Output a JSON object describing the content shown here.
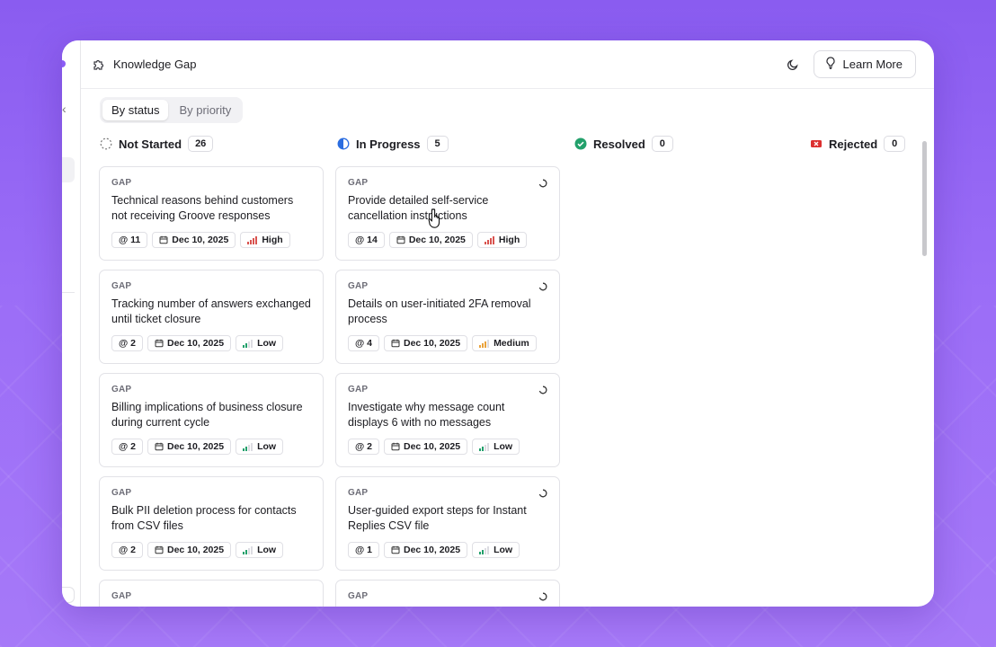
{
  "app": {
    "title": "Knowledge Gap"
  },
  "header": {
    "learn_more_label": "Learn More"
  },
  "view_toggle": {
    "options": [
      "By status",
      "By priority"
    ],
    "active": "By status"
  },
  "columns": [
    {
      "name": "Not Started",
      "count": "26"
    },
    {
      "name": "In Progress",
      "count": "5"
    },
    {
      "name": "Resolved",
      "count": "0"
    },
    {
      "name": "Rejected",
      "count": "0"
    }
  ],
  "cards": {
    "not_started": [
      {
        "tag": "GAP",
        "title": "Technical reasons behind customers not receiving Groove responses",
        "mentions": "@ 11",
        "date": "Dec 10, 2025",
        "priority": "High"
      },
      {
        "tag": "GAP",
        "title": "Tracking number of answers exchanged until ticket closure",
        "mentions": "@ 2",
        "date": "Dec 10, 2025",
        "priority": "Low"
      },
      {
        "tag": "GAP",
        "title": "Billing implications of business closure during current cycle",
        "mentions": "@ 2",
        "date": "Dec 10, 2025",
        "priority": "Low"
      },
      {
        "tag": "GAP",
        "title": "Bulk PII deletion process for contacts from CSV files",
        "mentions": "@ 2",
        "date": "Dec 10, 2025",
        "priority": "Low"
      },
      {
        "tag": "GAP"
      }
    ],
    "in_progress": [
      {
        "tag": "GAP",
        "title": "Provide detailed self-service cancellation instructions",
        "mentions": "@ 14",
        "date": "Dec 10, 2025",
        "priority": "High"
      },
      {
        "tag": "GAP",
        "title": "Details on user-initiated 2FA removal process",
        "mentions": "@ 4",
        "date": "Dec 10, 2025",
        "priority": "Medium"
      },
      {
        "tag": "GAP",
        "title": "Investigate why message count displays 6 with no messages",
        "mentions": "@ 2",
        "date": "Dec 10, 2025",
        "priority": "Low"
      },
      {
        "tag": "GAP",
        "title": "User-guided export steps for Instant Replies CSV file",
        "mentions": "@ 1",
        "date": "Dec 10, 2025",
        "priority": "Low"
      },
      {
        "tag": "GAP"
      }
    ]
  },
  "colors": {
    "accent": "#8b5cf6",
    "priority_high": "#d9534f",
    "priority_medium": "#e9a23b",
    "priority_low": "#22a06b",
    "resolved": "#22a06b",
    "rejected": "#dc2f2f",
    "in_progress": "#2b6de0"
  },
  "icons": {
    "title": "puzzle-icon",
    "theme": "moon-icon",
    "learn": "lightbulb-icon",
    "not_started": "dashed-circle-icon",
    "in_progress": "half-circle-icon",
    "resolved": "check-circle-icon",
    "rejected": "x-square-icon",
    "date": "calendar-icon",
    "priority": "signal-bars-icon",
    "status": "loading-icon"
  }
}
